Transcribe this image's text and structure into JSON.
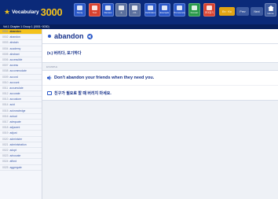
{
  "app": {
    "logo_word": "Vocabulary",
    "logo_number": "3000"
  },
  "toolbar": {
    "buttons": [
      {
        "label": "Study",
        "icon": "person-icon",
        "color": "#2a58c9"
      },
      {
        "label": "Test",
        "icon": "test-icon",
        "color": "#d9412f"
      },
      {
        "label": "Review",
        "icon": "review-icon",
        "color": "#2a58c9"
      },
      {
        "label": "-1-",
        "icon": "number-icon",
        "color": "#5a6f9d"
      },
      {
        "label": "-1/1-",
        "icon": "range-icon",
        "color": "#5a6f9d"
      },
      {
        "label": "Definition",
        "icon": "definition-icon",
        "color": "#2a58c9"
      },
      {
        "label": "Example",
        "icon": "example-icon",
        "color": "#2a58c9"
      },
      {
        "label": "Pronounce",
        "icon": "pronounce-icon",
        "color": "#2a58c9"
      },
      {
        "label": "Korean",
        "icon": "korean-icon",
        "color": "#2a9a4a"
      },
      {
        "label": "즐겨찾기",
        "icon": "star-icon",
        "color": "#d9412f"
      }
    ],
    "pills": [
      {
        "label": "En · Ko",
        "color": "#e1a514"
      },
      {
        "label": "Prev",
        "color": "#3e5b9f"
      },
      {
        "label": "Next",
        "color": "#3e5b9f"
      }
    ],
    "home_label": "Home"
  },
  "chapter": {
    "label": "Vol.1 Chapter 1   Group 1 (0001~0030)"
  },
  "sidebar": {
    "items": [
      {
        "num": "0001",
        "word": "abandon"
      },
      {
        "num": "0002",
        "word": "abandon"
      },
      {
        "num": "0003",
        "word": "abstain"
      },
      {
        "num": "0004",
        "word": "academy"
      },
      {
        "num": "0005",
        "word": "abstract"
      },
      {
        "num": "0006",
        "word": "accessible"
      },
      {
        "num": "0007",
        "word": "access"
      },
      {
        "num": "0008",
        "word": "accommodate"
      },
      {
        "num": "0009",
        "word": "accord"
      },
      {
        "num": "0010",
        "word": "account"
      },
      {
        "num": "0011",
        "word": "accumulate"
      },
      {
        "num": "0012",
        "word": "accurate"
      },
      {
        "num": "0013",
        "word": "accustom"
      },
      {
        "num": "0014",
        "word": "acid"
      },
      {
        "num": "0015",
        "word": "acknowledge"
      },
      {
        "num": "0016",
        "word": "actual"
      },
      {
        "num": "0017",
        "word": "adequate"
      },
      {
        "num": "0018",
        "word": "adjacent"
      },
      {
        "num": "0019",
        "word": "adjust"
      },
      {
        "num": "0020",
        "word": "administer"
      },
      {
        "num": "0021",
        "word": "administration"
      },
      {
        "num": "0022",
        "word": "adopt"
      },
      {
        "num": "0023",
        "word": "advocate"
      },
      {
        "num": "0024",
        "word": "afford"
      },
      {
        "num": "0025",
        "word": "aggregate"
      }
    ],
    "active_index": 0
  },
  "entry": {
    "word": "abandon",
    "meaning": "(v.) 버리다, 포기하다",
    "example_label": "EXAMPLE",
    "example_en": "Don't abandon your friends when they need you.",
    "example_ko": "친구가 필요로 할 때 버리지 마세요."
  },
  "colors": {
    "header_bg": "#0b2a79",
    "accent_yellow": "#f4c21c",
    "text_blue": "#16318a",
    "page_bg": "#eef1f6"
  }
}
